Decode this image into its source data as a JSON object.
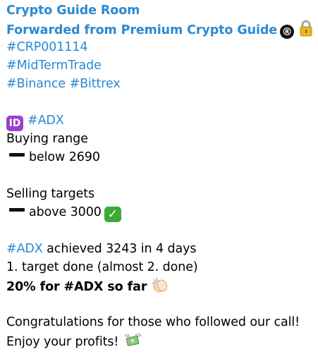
{
  "message": {
    "channel": "Crypto Guide Room",
    "forwarded": "Forwarded from Premium Crypto Guide",
    "tags": [
      "#CRP001114",
      "#MidTermTrade",
      "#Binance",
      "#Bittrex"
    ],
    "coin_tag": "#ADX",
    "buying_label": "Buying range",
    "buying_value": "below 2690",
    "selling_label": "Selling targets",
    "selling_value": "above 3000",
    "achieved_text": "achieved 3243 in 4 days",
    "target_line": "1. target done (almost 2. done)",
    "profit_pre": "20% for ",
    "profit_post": " so far",
    "congrats": "Congratulations for those who followed our call!",
    "enjoy": "Enjoy your profits!"
  },
  "icons": {
    "registered": "®",
    "lock": "lock-icon",
    "id": "ID",
    "check": "✓",
    "clap": "clapping-hands-icon",
    "money": "money-with-wings-icon"
  },
  "colors": {
    "link": "#2a8ad4",
    "text": "#000000",
    "id_badge": "#9b3fd0",
    "check_badge": "#3ea83a"
  }
}
